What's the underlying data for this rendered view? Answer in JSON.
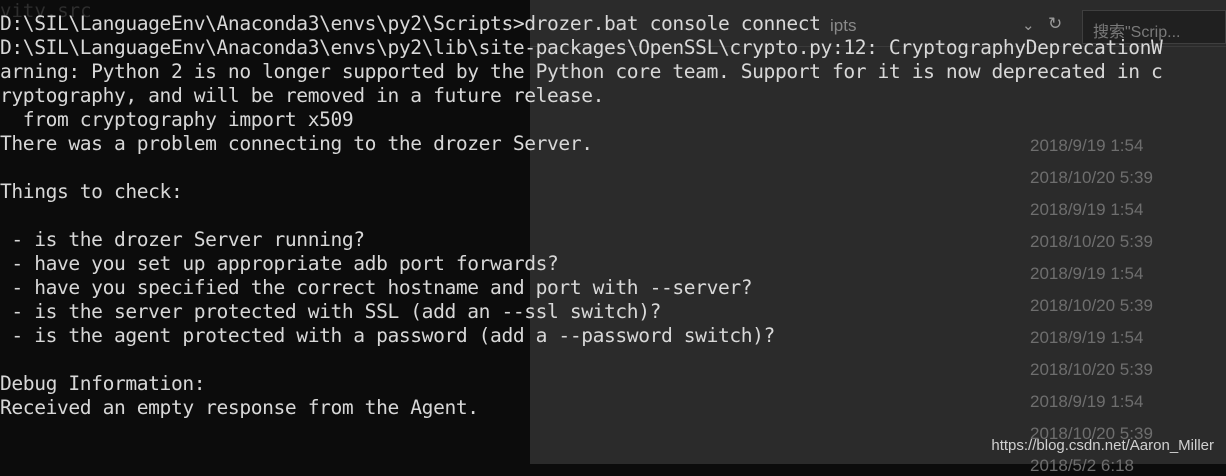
{
  "explorer": {
    "path_fragment": "ipts",
    "search_placeholder": "搜索\"Scrip...",
    "files": [
      {
        "name": "",
        "date": ""
      },
      {
        "name": "",
        "date": "2018/9/19 1:54"
      },
      {
        "name": "",
        "date": "2018/10/20 5:39"
      },
      {
        "name": "",
        "date": "2018/9/19 1:54"
      },
      {
        "name": "",
        "date": "2018/10/20 5:39"
      },
      {
        "name": "",
        "date": "2018/9/19 1:54"
      },
      {
        "name": "",
        "date": "2018/10/20 5:39"
      },
      {
        "name": "",
        "date": "2018/9/19 1:54"
      },
      {
        "name": "",
        "date": "2018/10/20 5:39"
      },
      {
        "name": "",
        "date": "2018/9/19 1:54"
      },
      {
        "name": "",
        "date": "2018/10/20 5:39"
      },
      {
        "name": "",
        "date": "2018/5/2 6:18"
      }
    ]
  },
  "terminal": {
    "ghost_title": "vity.src",
    "lines": [
      "D:\\SIL\\LanguageEnv\\Anaconda3\\envs\\py2\\Scripts>drozer.bat console connect",
      "D:\\SIL\\LanguageEnv\\Anaconda3\\envs\\py2\\lib\\site-packages\\OpenSSL\\crypto.py:12: CryptographyDeprecationW",
      "arning: Python 2 is no longer supported by the Python core team. Support for it is now deprecated in c",
      "ryptography, and will be removed in a future release.",
      "  from cryptography import x509",
      "There was a problem connecting to the drozer Server.",
      "",
      "Things to check:",
      "",
      " - is the drozer Server running?",
      " - have you set up appropriate adb port forwards?",
      " - have you specified the correct hostname and port with --server?",
      " - is the server protected with SSL (add an --ssl switch)?",
      " - is the agent protected with a password (add a --password switch)?",
      "",
      "Debug Information:",
      "Received an empty response from the Agent."
    ]
  },
  "watermark": "https://blog.csdn.net/Aaron_Miller"
}
